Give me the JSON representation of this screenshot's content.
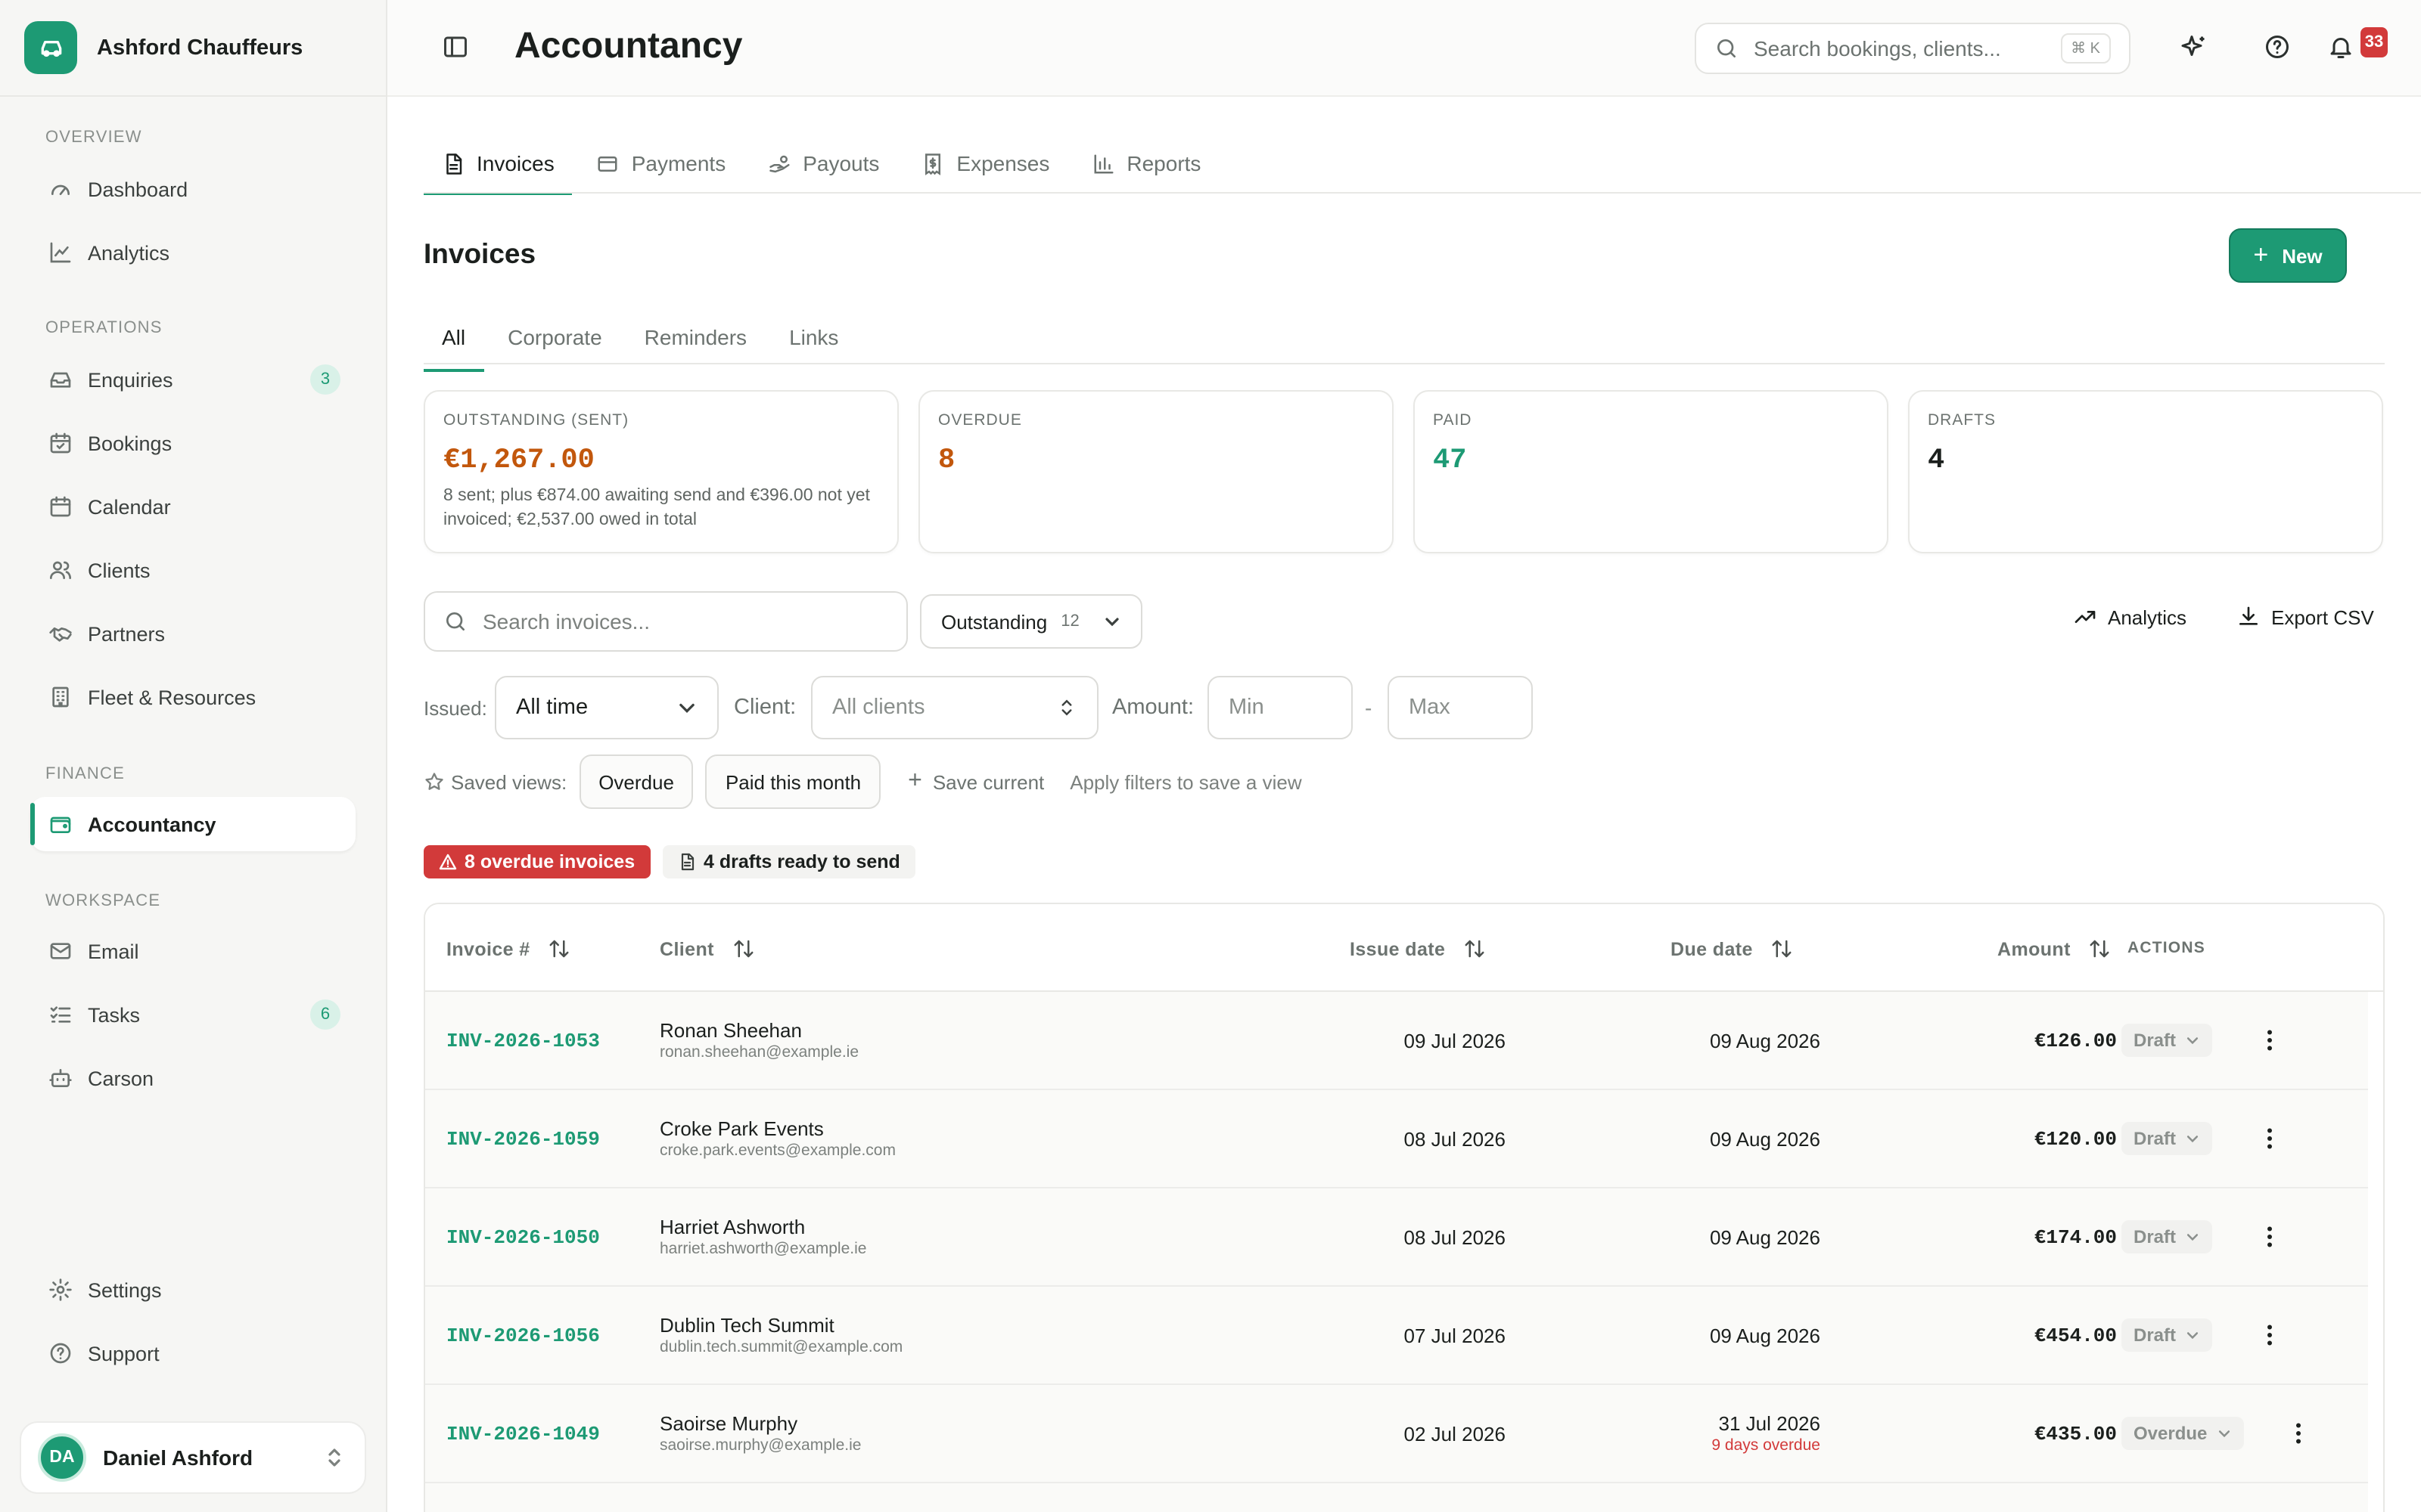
{
  "brand": {
    "name": "Ashford Chauffeurs"
  },
  "sidebar": {
    "sections": {
      "overview": "OVERVIEW",
      "operations": "OPERATIONS",
      "finance": "FINANCE",
      "workspace": "WORKSPACE"
    },
    "items": {
      "dashboard": {
        "label": "Dashboard",
        "icon": "gauge-icon"
      },
      "analytics": {
        "label": "Analytics",
        "icon": "line-chart-icon"
      },
      "enquiries": {
        "label": "Enquiries",
        "icon": "inbox-icon",
        "badge": "3"
      },
      "bookings": {
        "label": "Bookings",
        "icon": "calendar-check-icon"
      },
      "calendar": {
        "label": "Calendar",
        "icon": "calendar-icon"
      },
      "clients": {
        "label": "Clients",
        "icon": "users-icon"
      },
      "partners": {
        "label": "Partners",
        "icon": "handshake-icon"
      },
      "fleet": {
        "label": "Fleet & Resources",
        "icon": "building-icon"
      },
      "accountancy": {
        "label": "Accountancy",
        "icon": "wallet-icon",
        "active": true
      },
      "email": {
        "label": "Email",
        "icon": "mail-icon"
      },
      "tasks": {
        "label": "Tasks",
        "icon": "list-checks-icon",
        "badge": "6"
      },
      "carson": {
        "label": "Carson",
        "icon": "bot-icon"
      },
      "settings": {
        "label": "Settings",
        "icon": "gear-icon"
      },
      "support": {
        "label": "Support",
        "icon": "help-circle-icon"
      }
    },
    "user": {
      "initials": "DA",
      "name": "Daniel Ashford"
    }
  },
  "header": {
    "title": "Accountancy",
    "search_placeholder": "Search bookings, clients...",
    "shortcut": "⌘ K",
    "notification_count": "33"
  },
  "tabs": [
    {
      "label": "Invoices",
      "icon": "file-text-icon",
      "active": true
    },
    {
      "label": "Payments",
      "icon": "credit-card-icon"
    },
    {
      "label": "Payouts",
      "icon": "hand-coins-icon"
    },
    {
      "label": "Expenses",
      "icon": "receipt-icon"
    },
    {
      "label": "Reports",
      "icon": "bar-chart-icon"
    }
  ],
  "invoices": {
    "title": "Invoices",
    "new_label": "New",
    "subtabs": [
      "All",
      "Corporate",
      "Reminders",
      "Links"
    ],
    "stats": {
      "outstanding": {
        "label": "OUTSTANDING (SENT)",
        "value": "€1,267.00",
        "note": "8 sent; plus €874.00 awaiting send and €396.00 not yet invoiced; €2,537.00 owed in total",
        "color": "#c2570c"
      },
      "overdue": {
        "label": "OVERDUE",
        "value": "8",
        "color": "#c2570c"
      },
      "paid": {
        "label": "PAID",
        "value": "47",
        "color": "#1d9a74"
      },
      "drafts": {
        "label": "DRAFTS",
        "value": "4",
        "color": "#1b1f1d"
      }
    },
    "search_placeholder": "Search invoices...",
    "status_filter": {
      "label": "Outstanding",
      "count": "12"
    },
    "analytics_label": "Analytics",
    "export_label": "Export CSV",
    "filters": {
      "issued_label": "Issued:",
      "issued_value": "All time",
      "client_label": "Client:",
      "client_value": "All clients",
      "amount_label": "Amount:",
      "min_placeholder": "Min",
      "dash": "-",
      "max_placeholder": "Max"
    },
    "saved_views": {
      "label": "Saved views:",
      "views": [
        "Overdue",
        "Paid this month"
      ],
      "save_current": "Save current",
      "hint": "Apply filters to save a view"
    },
    "alerts": {
      "overdue": "8 overdue invoices",
      "drafts": "4 drafts ready to send"
    },
    "table": {
      "columns": {
        "invoice": "Invoice #",
        "client": "Client",
        "issue_date": "Issue date",
        "due_date": "Due date",
        "amount": "Amount",
        "actions": "ACTIONS"
      },
      "rows": [
        {
          "invoice": "INV-2026-1053",
          "client": "Ronan Sheehan",
          "email": "ronan.sheehan@example.ie",
          "issue": "09 Jul 2026",
          "due": "09 Aug 2026",
          "due_note": "",
          "amount": "€126.00",
          "status": "Draft"
        },
        {
          "invoice": "INV-2026-1059",
          "client": "Croke Park Events",
          "email": "croke.park.events@example.com",
          "issue": "08 Jul 2026",
          "due": "09 Aug 2026",
          "due_note": "",
          "amount": "€120.00",
          "status": "Draft"
        },
        {
          "invoice": "INV-2026-1050",
          "client": "Harriet Ashworth",
          "email": "harriet.ashworth@example.ie",
          "issue": "08 Jul 2026",
          "due": "09 Aug 2026",
          "due_note": "",
          "amount": "€174.00",
          "status": "Draft"
        },
        {
          "invoice": "INV-2026-1056",
          "client": "Dublin Tech Summit",
          "email": "dublin.tech.summit@example.com",
          "issue": "07 Jul 2026",
          "due": "09 Aug 2026",
          "due_note": "",
          "amount": "€454.00",
          "status": "Draft"
        },
        {
          "invoice": "INV-2026-1049",
          "client": "Saoirse Murphy",
          "email": "saoirse.murphy@example.ie",
          "issue": "02 Jul 2026",
          "due": "31 Jul 2026",
          "due_note": "9 days overdue",
          "amount": "€435.00",
          "status": "Overdue"
        }
      ]
    }
  }
}
